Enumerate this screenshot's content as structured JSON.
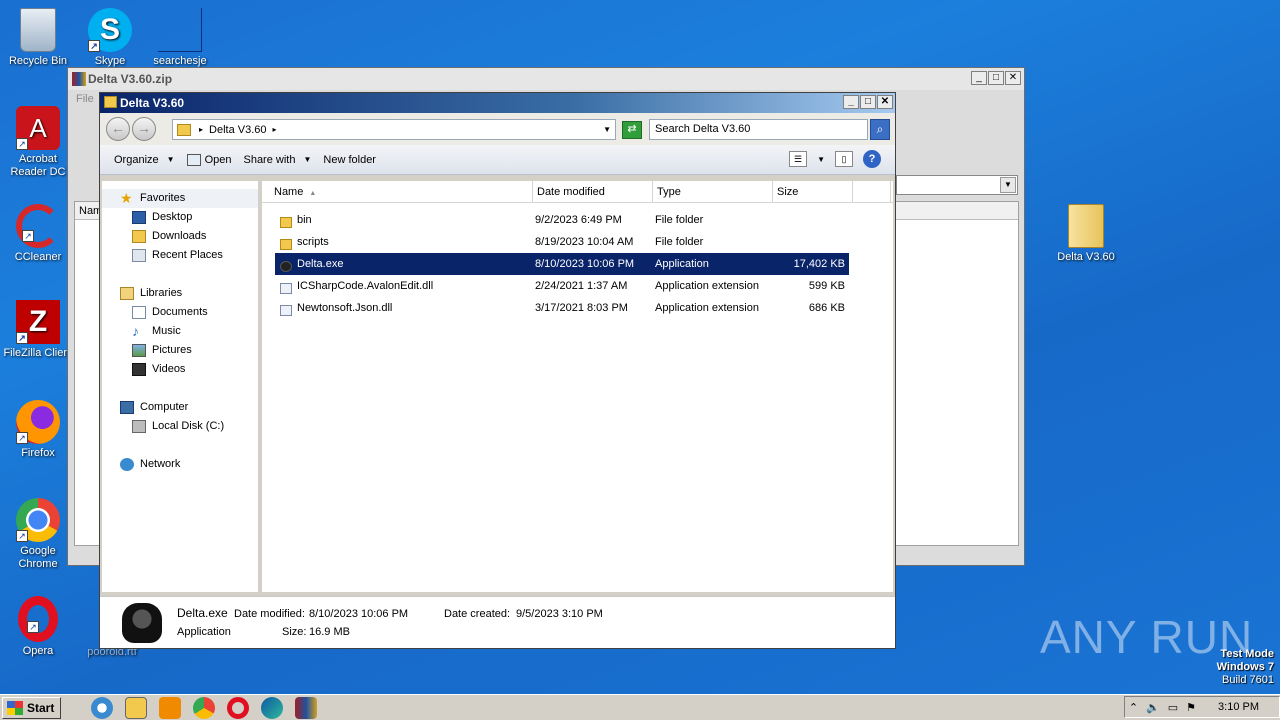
{
  "desktop": {
    "icons": [
      {
        "label": "Recycle Bin"
      },
      {
        "label": "Skype"
      },
      {
        "label": "searchesje"
      },
      {
        "label": "Acrobat Reader DC"
      },
      {
        "label": "CCleaner"
      },
      {
        "label": "FileZilla Client"
      },
      {
        "label": "Firefox"
      },
      {
        "label": "Google Chrome"
      },
      {
        "label": "Opera"
      },
      {
        "label": "poorold.rtf"
      },
      {
        "label": "Delta V3.60"
      }
    ]
  },
  "rar_window": {
    "title": "Delta V3.60.zip",
    "menu_file": "File",
    "list_header_name": "Nam"
  },
  "explorer": {
    "title": "Delta V3.60",
    "address": {
      "crumb": "Delta V3.60"
    },
    "search": {
      "placeholder": "Search Delta V3.60"
    },
    "toolbar": {
      "organize": "Organize",
      "open": "Open",
      "share_with": "Share with",
      "new_folder": "New folder"
    },
    "nav": {
      "favorites": "Favorites",
      "desktop": "Desktop",
      "downloads": "Downloads",
      "recent_places": "Recent Places",
      "libraries": "Libraries",
      "documents": "Documents",
      "music": "Music",
      "pictures": "Pictures",
      "videos": "Videos",
      "computer": "Computer",
      "local_disk": "Local Disk (C:)",
      "network": "Network"
    },
    "columns": {
      "name": "Name",
      "date_modified": "Date modified",
      "type": "Type",
      "size": "Size"
    },
    "files": [
      {
        "name": "bin",
        "date": "9/2/2023 6:49 PM",
        "type": "File folder",
        "size": "",
        "icon": "folder-icon"
      },
      {
        "name": "scripts",
        "date": "8/19/2023 10:04 AM",
        "type": "File folder",
        "size": "",
        "icon": "folder-icon"
      },
      {
        "name": "Delta.exe",
        "date": "8/10/2023 10:06 PM",
        "type": "Application",
        "size": "17,402 KB",
        "icon": "application-icon",
        "selected": true
      },
      {
        "name": "ICSharpCode.AvalonEdit.dll",
        "date": "2/24/2021 1:37 AM",
        "type": "Application extension",
        "size": "599 KB",
        "icon": "dll-icon"
      },
      {
        "name": "Newtonsoft.Json.dll",
        "date": "3/17/2021 8:03 PM",
        "type": "Application extension",
        "size": "686 KB",
        "icon": "dll-icon"
      }
    ],
    "details": {
      "name": "Delta.exe",
      "type": "Application",
      "date_modified_label": "Date modified:",
      "date_modified": "8/10/2023 10:06 PM",
      "size_label": "Size:",
      "size": "16.9 MB",
      "date_created_label": "Date created:",
      "date_created": "9/5/2023 3:10 PM"
    }
  },
  "watermark": {
    "text": "ANY RUN",
    "test_mode": "Test Mode",
    "os": "Windows 7",
    "build": "Build 7601"
  },
  "taskbar": {
    "start": "Start",
    "clock": "3:10 PM"
  },
  "colors": {
    "selection": "#0a246a",
    "title_active": "#0a246a",
    "desktop": "#1a6fd0"
  }
}
